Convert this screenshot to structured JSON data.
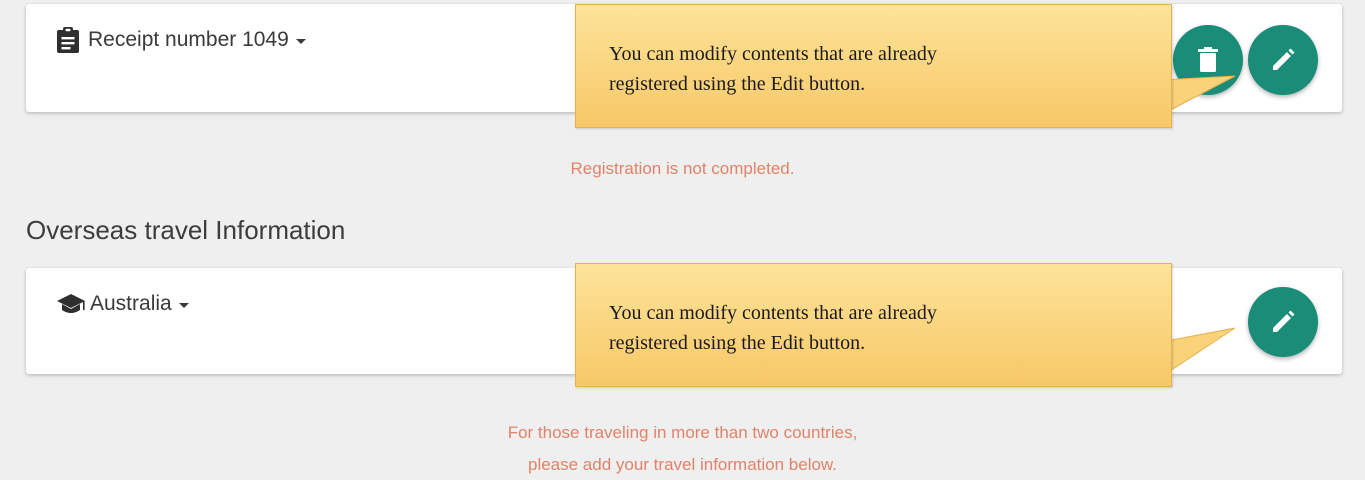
{
  "receipt_card": {
    "label": "Receipt number 1049",
    "icon": "clipboard-icon",
    "delete_icon": "trash-icon",
    "edit_icon": "pencil-icon"
  },
  "registration_notice": "Registration is not completed.",
  "travel_section": {
    "title": "Overseas travel Information",
    "country_label": "Australia",
    "icon": "graduation-cap-icon",
    "edit_icon": "pencil-icon"
  },
  "travel_notice": {
    "line1": "For those traveling in more than two countries,",
    "line2": "please add your travel information below."
  },
  "callouts": {
    "top": {
      "line1": "You can modify contents that are already",
      "line2": "registered using the Edit button."
    },
    "bottom": {
      "line1": "You can modify contents that are already",
      "line2": "registered using the Edit button."
    }
  },
  "colors": {
    "accent": "#1a8c78",
    "notice": "#e0836a",
    "callout_fill": "#f9d27a",
    "background": "#efefef"
  }
}
